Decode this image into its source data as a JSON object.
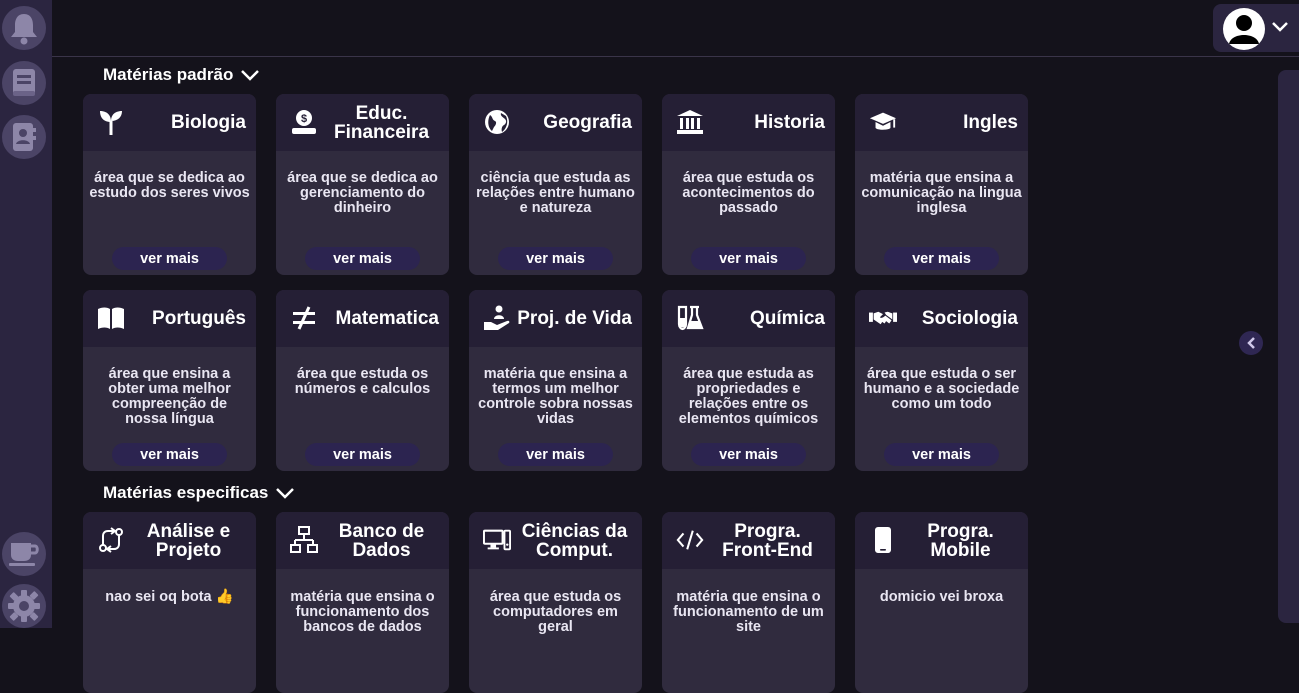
{
  "sections": {
    "padrao_title": "Matérias padrão",
    "especificas_title": "Matérias especificas"
  },
  "cards_padrao": [
    {
      "title": "Biologia",
      "icon": "seedling-icon",
      "desc": "área que se dedica ao estudo dos seres vivos",
      "button": "ver mais"
    },
    {
      "title": "Educ. Financeira",
      "icon": "money-bag-icon",
      "desc": "área que se dedica ao gerenciamento do dinheiro",
      "button": "ver mais"
    },
    {
      "title": "Geografia",
      "icon": "globe-icon",
      "desc": "ciência que estuda as relações entre humano e natureza",
      "button": "ver mais"
    },
    {
      "title": "Historia",
      "icon": "landmark-icon",
      "desc": "área que estuda os acontecimentos do passado",
      "button": "ver mais"
    },
    {
      "title": "Ingles",
      "icon": "graduation-cap-icon",
      "desc": "matéria que ensina a comunicação na lingua inglesa",
      "button": "ver mais"
    },
    {
      "title": "Português",
      "icon": "book-open-icon",
      "desc": "área que ensina a obter uma melhor compreenção de nossa língua",
      "button": "ver mais"
    },
    {
      "title": "Matematica",
      "icon": "not-equal-icon",
      "desc": "área que estuda os números e calculos",
      "button": "ver mais"
    },
    {
      "title": "Proj. de Vida",
      "icon": "hand-holding-person-icon",
      "desc": "matéria que ensina a termos um melhor controle sobra nossas vidas",
      "button": "ver mais"
    },
    {
      "title": "Química",
      "icon": "flask-icon",
      "desc": "área que estuda as propriedades e relações entre os elementos químicos",
      "button": "ver mais"
    },
    {
      "title": "Sociologia",
      "icon": "handshake-icon",
      "desc": "área que estuda o ser humano e a sociedade como um todo",
      "button": "ver mais"
    }
  ],
  "cards_especificas": [
    {
      "title": "Análise e Projeto",
      "icon": "arrows-rotate-icon",
      "desc": "nao sei oq bota 👍"
    },
    {
      "title": "Banco de Dados",
      "icon": "network-icon",
      "desc": "matéria que ensina o funcionamento dos bancos de dados"
    },
    {
      "title": "Ciências da Comput.",
      "icon": "computer-icon",
      "desc": "área que estuda os computadores em geral"
    },
    {
      "title": "Progra. Front-End",
      "icon": "code-icon",
      "desc": "matéria que ensina o funcionamento de um site"
    },
    {
      "title": "Progra. Mobile",
      "icon": "mobile-icon",
      "desc": "domicio vei broxa"
    }
  ],
  "colors": {
    "background": "#14121b",
    "sidebar": "#2b2540",
    "card": "#302b3e",
    "card_header": "#251f35",
    "button": "#2c2450"
  }
}
